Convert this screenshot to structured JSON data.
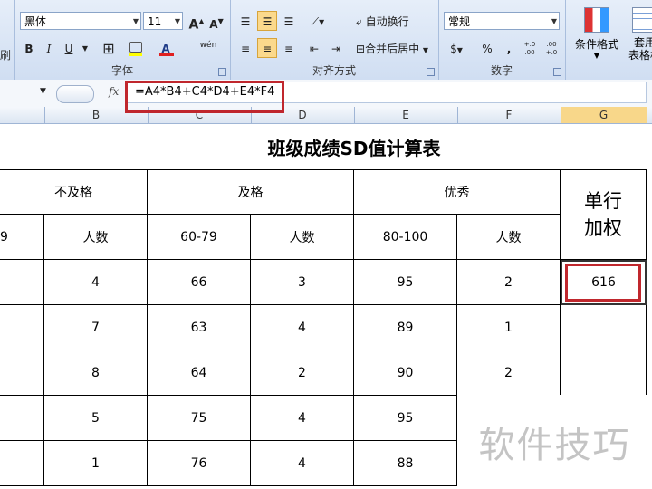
{
  "ribbon": {
    "font_name": "黑体",
    "font_size": "11",
    "grow_font": "A",
    "shrink_font": "A",
    "bold": "B",
    "italic": "I",
    "underline": "U",
    "font_color_letter": "A",
    "phonetic": "wén",
    "font_group": "字体",
    "wrap_text": "自动换行",
    "merge_center": "合并后居中",
    "alignment_group": "对齐方式",
    "number_format": "常规",
    "currency": "$",
    "percent": "%",
    "comma": ",",
    "inc_decimal": "+.0 .00",
    "dec_decimal": ".00 +.0",
    "number_group": "数字",
    "cond_format": "条件格式",
    "table_format_1": "套用",
    "table_format_2": "表格格",
    "left_edge_text": "刷"
  },
  "formula_bar": {
    "fx": "fx",
    "formula": "=A4*B4+C4*D4+E4*F4"
  },
  "columns": [
    "B",
    "C",
    "D",
    "E",
    "F",
    "G"
  ],
  "sheet": {
    "title": "班级成绩SD值计算表",
    "group_headers": [
      "不及格",
      "及格",
      "优秀"
    ],
    "weight_header_1": "单行",
    "weight_header_2": "加权",
    "sub_headers": [
      "9",
      "人数",
      "60-79",
      "人数",
      "80-100",
      "人数"
    ],
    "rows": [
      [
        "4",
        "66",
        "3",
        "95",
        "2",
        "616"
      ],
      [
        "7",
        "63",
        "4",
        "89",
        "1",
        ""
      ],
      [
        "8",
        "64",
        "2",
        "90",
        "2",
        ""
      ],
      [
        "5",
        "75",
        "4",
        "95",
        "",
        ""
      ],
      [
        "1",
        "76",
        "4",
        "88",
        "",
        ""
      ]
    ]
  },
  "watermark": "软件技巧",
  "colors": {
    "highlight": "#c0272d",
    "ribbon": "#dbe6f4"
  }
}
